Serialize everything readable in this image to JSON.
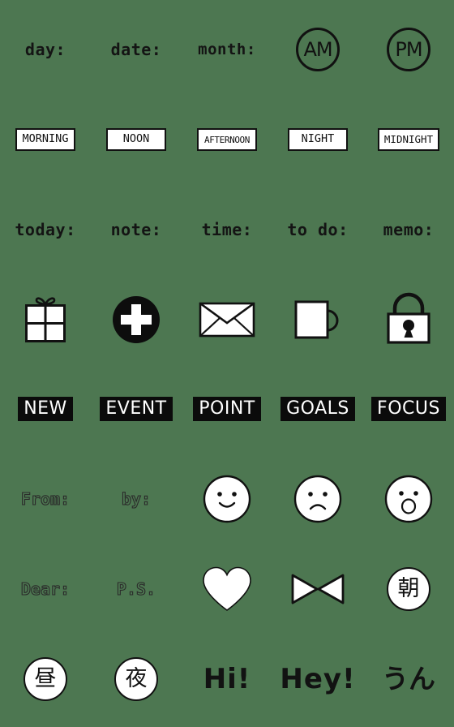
{
  "sheet": {
    "background_color": "#4d7751",
    "ink_color": "#111111",
    "paper_color": "#ffffff",
    "columns": 5,
    "rows": 8
  },
  "stickers": [
    {
      "id": "day",
      "kind": "text",
      "label": "day:"
    },
    {
      "id": "date",
      "kind": "text",
      "label": "date:"
    },
    {
      "id": "month",
      "kind": "text",
      "label": "month:"
    },
    {
      "id": "am",
      "kind": "ring-text",
      "label": "AM"
    },
    {
      "id": "pm",
      "kind": "ring-text",
      "label": "PM"
    },
    {
      "id": "morning",
      "kind": "white-box",
      "label": "MORNING"
    },
    {
      "id": "noon",
      "kind": "white-box",
      "label": "NOON"
    },
    {
      "id": "afternoon",
      "kind": "white-box",
      "label": "AFTERNOON"
    },
    {
      "id": "night",
      "kind": "white-box",
      "label": "NIGHT"
    },
    {
      "id": "midnight",
      "kind": "white-box",
      "label": "MIDNIGHT"
    },
    {
      "id": "today",
      "kind": "text",
      "label": "today:"
    },
    {
      "id": "note",
      "kind": "text",
      "label": "note:"
    },
    {
      "id": "time",
      "kind": "text",
      "label": "time:"
    },
    {
      "id": "todo",
      "kind": "text",
      "label": "to do:"
    },
    {
      "id": "memo",
      "kind": "text",
      "label": "memo:"
    },
    {
      "id": "gift",
      "kind": "icon",
      "icon": "gift-box-icon",
      "label": ""
    },
    {
      "id": "plus",
      "kind": "icon",
      "icon": "plus-circle-icon",
      "label": ""
    },
    {
      "id": "mail",
      "kind": "icon",
      "icon": "envelope-icon",
      "label": ""
    },
    {
      "id": "mug",
      "kind": "icon",
      "icon": "mug-icon",
      "label": ""
    },
    {
      "id": "lock",
      "kind": "icon",
      "icon": "padlock-icon",
      "label": ""
    },
    {
      "id": "new",
      "kind": "black-box",
      "label": "NEW"
    },
    {
      "id": "event",
      "kind": "black-box",
      "label": "EVENT"
    },
    {
      "id": "point",
      "kind": "black-box",
      "label": "POINT"
    },
    {
      "id": "goals",
      "kind": "black-box",
      "label": "GOALS"
    },
    {
      "id": "focus",
      "kind": "black-box",
      "label": "FOCUS"
    },
    {
      "id": "from",
      "kind": "outline-text",
      "label": "From:"
    },
    {
      "id": "by",
      "kind": "outline-text",
      "label": "by:"
    },
    {
      "id": "smile",
      "kind": "icon",
      "icon": "smiling-face-icon",
      "label": ""
    },
    {
      "id": "sad",
      "kind": "icon",
      "icon": "frowning-face-icon",
      "label": ""
    },
    {
      "id": "surprised",
      "kind": "icon",
      "icon": "surprised-face-icon",
      "label": ""
    },
    {
      "id": "dear",
      "kind": "outline-text",
      "label": "Dear:"
    },
    {
      "id": "ps",
      "kind": "outline-text",
      "label": "P.S."
    },
    {
      "id": "heart",
      "kind": "icon",
      "icon": "heart-icon",
      "label": ""
    },
    {
      "id": "ribbon",
      "kind": "icon",
      "icon": "bowtie-icon",
      "label": ""
    },
    {
      "id": "asa",
      "kind": "kanji-circle",
      "label": "朝"
    },
    {
      "id": "hiru",
      "kind": "kanji-circle",
      "label": "昼"
    },
    {
      "id": "yoru",
      "kind": "kanji-circle",
      "label": "夜"
    },
    {
      "id": "hi",
      "kind": "big-text",
      "label": "Hi!"
    },
    {
      "id": "hey",
      "kind": "big-text",
      "label": "Hey!"
    },
    {
      "id": "un",
      "kind": "big-text-jp",
      "label": "うん"
    }
  ]
}
